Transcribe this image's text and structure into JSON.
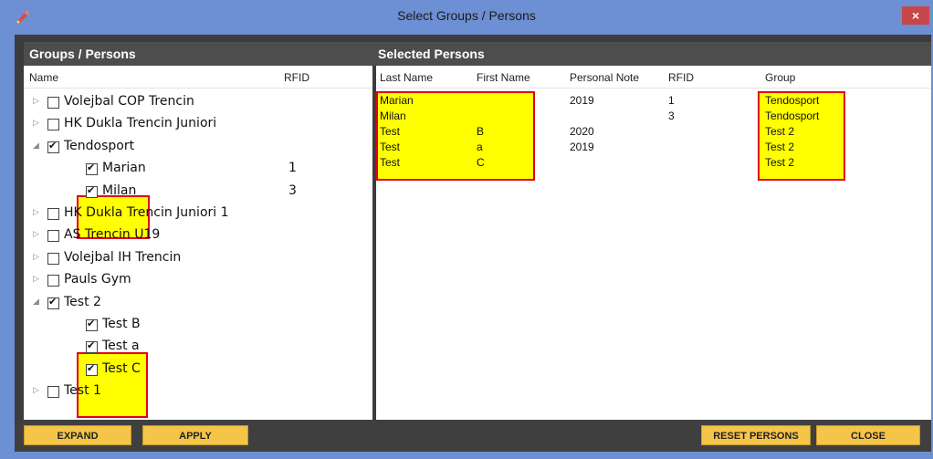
{
  "window": {
    "title": "Select Groups / Persons",
    "close_symbol": "×"
  },
  "left": {
    "header": "Groups / Persons",
    "columns": {
      "name": "Name",
      "rfid": "RFID"
    },
    "tree": [
      {
        "label": "Volejbal COP Trencin",
        "type": "group",
        "expanded": false,
        "checked": false,
        "rfid": ""
      },
      {
        "label": "HK Dukla Trencin Juniori",
        "type": "group",
        "expanded": false,
        "checked": false,
        "rfid": ""
      },
      {
        "label": "Tendosport",
        "type": "group",
        "expanded": true,
        "checked": true,
        "rfid": ""
      },
      {
        "label": "Marian",
        "type": "person",
        "checked": true,
        "rfid": "1"
      },
      {
        "label": "Milan",
        "type": "person",
        "checked": true,
        "rfid": "3"
      },
      {
        "label": "HK Dukla Trencin Juniori 1",
        "type": "group",
        "expanded": false,
        "checked": false,
        "rfid": ""
      },
      {
        "label": "AS Trencin U19",
        "type": "group",
        "expanded": false,
        "checked": false,
        "rfid": ""
      },
      {
        "label": "Volejbal IH Trencin",
        "type": "group",
        "expanded": false,
        "checked": false,
        "rfid": ""
      },
      {
        "label": "Pauls Gym",
        "type": "group",
        "expanded": false,
        "checked": false,
        "rfid": ""
      },
      {
        "label": "Test 2",
        "type": "group",
        "expanded": true,
        "checked": true,
        "rfid": ""
      },
      {
        "label": "Test B",
        "type": "person",
        "checked": true,
        "rfid": ""
      },
      {
        "label": "Test a",
        "type": "person",
        "checked": true,
        "rfid": ""
      },
      {
        "label": "Test  C",
        "type": "person",
        "checked": true,
        "rfid": ""
      },
      {
        "label": "Test 1",
        "type": "group",
        "expanded": false,
        "checked": false,
        "rfid": ""
      }
    ]
  },
  "right": {
    "header": "Selected Persons",
    "columns": {
      "last_name": "Last Name",
      "first_name": "First Name",
      "personal_note": "Personal Note",
      "rfid": "RFID",
      "group": "Group"
    },
    "rows": [
      {
        "last_name": "Marian",
        "first_name": "",
        "personal_note": "2019",
        "rfid": "1",
        "group": "Tendosport"
      },
      {
        "last_name": "Milan",
        "first_name": "",
        "personal_note": "",
        "rfid": "3",
        "group": "Tendosport"
      },
      {
        "last_name": "Test",
        "first_name": "B",
        "personal_note": "2020",
        "rfid": "",
        "group": "Test 2"
      },
      {
        "last_name": "Test",
        "first_name": "a",
        "personal_note": "2019",
        "rfid": "",
        "group": "Test 2"
      },
      {
        "last_name": "Test",
        "first_name": "C",
        "personal_note": "",
        "rfid": "",
        "group": "Test 2"
      }
    ]
  },
  "buttons": {
    "expand": "EXPAND",
    "apply": "APPLY",
    "reset_persons": "RESET PERSONS",
    "close": "CLOSE"
  },
  "colors": {
    "title_bar": "#6d8fd3",
    "highlight": "#ffff00",
    "highlight_border": "#e0001a",
    "button": "#f5c54a"
  }
}
